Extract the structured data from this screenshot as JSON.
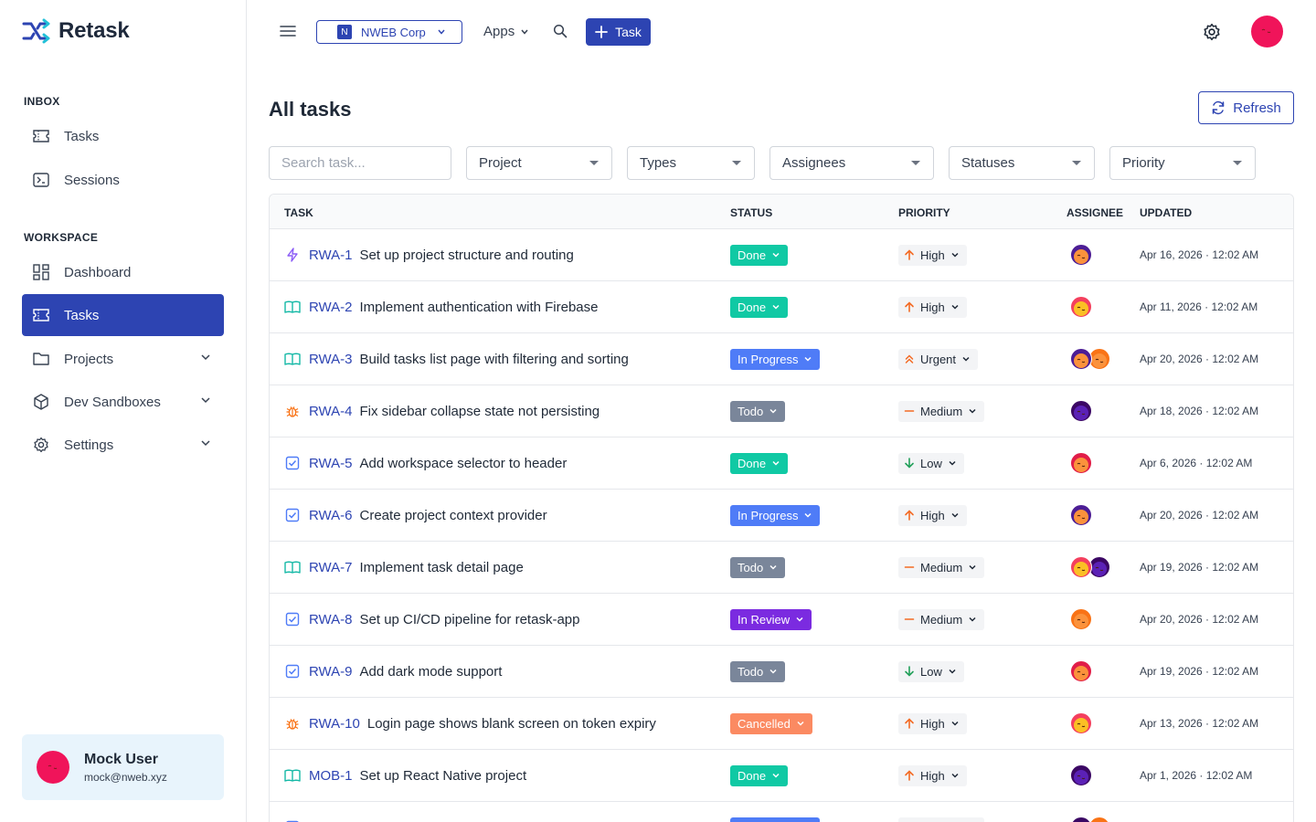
{
  "brand": {
    "name": "Retask"
  },
  "sidebar": {
    "inbox_label": "INBOX",
    "inbox_items": [
      {
        "label": "Tasks",
        "icon": "ticket-icon"
      },
      {
        "label": "Sessions",
        "icon": "terminal-icon"
      }
    ],
    "workspace_label": "WORKSPACE",
    "workspace_items": [
      {
        "label": "Dashboard",
        "icon": "dashboard-icon"
      },
      {
        "label": "Tasks",
        "icon": "ticket-icon",
        "active": true
      },
      {
        "label": "Projects",
        "icon": "folder-icon",
        "expandable": true
      },
      {
        "label": "Dev Sandboxes",
        "icon": "cube-icon",
        "expandable": true
      },
      {
        "label": "Settings",
        "icon": "gear-icon",
        "expandable": true
      }
    ],
    "user": {
      "name": "Mock User",
      "email": "mock@nweb.xyz"
    }
  },
  "header": {
    "org": {
      "badge": "N",
      "name": "NWEB Corp"
    },
    "apps_label": "Apps",
    "new_task_label": "Task"
  },
  "main": {
    "title": "All tasks",
    "refresh_label": "Refresh",
    "search_placeholder": "Search task...",
    "filters": [
      "Project",
      "Types",
      "Assignees",
      "Statuses",
      "Priority"
    ],
    "columns": [
      "TASK",
      "STATUS",
      "PRIORITY",
      "ASSIGNEE",
      "UPDATED"
    ],
    "rows": [
      {
        "type": "epic",
        "key": "RWA-1",
        "title": "Set up project structure and routing",
        "status": "Done",
        "priority": "High",
        "assignees": [
          "a1"
        ],
        "updated": "Apr 16, 2026 · 12:02 AM"
      },
      {
        "type": "story",
        "key": "RWA-2",
        "title": "Implement authentication with Firebase",
        "status": "Done",
        "priority": "High",
        "assignees": [
          "a2"
        ],
        "updated": "Apr 11, 2026 · 12:02 AM"
      },
      {
        "type": "story",
        "key": "RWA-3",
        "title": "Build tasks list page with filtering and sorting",
        "status": "In Progress",
        "priority": "Urgent",
        "assignees": [
          "a1",
          "a3"
        ],
        "updated": "Apr 20, 2026 · 12:02 AM"
      },
      {
        "type": "bug",
        "key": "RWA-4",
        "title": "Fix sidebar collapse state not persisting",
        "status": "Todo",
        "priority": "Medium",
        "assignees": [
          "a4"
        ],
        "updated": "Apr 18, 2026 · 12:02 AM"
      },
      {
        "type": "task",
        "key": "RWA-5",
        "title": "Add workspace selector to header",
        "status": "Done",
        "priority": "Low",
        "assignees": [
          "a5"
        ],
        "updated": "Apr 6, 2026 · 12:02 AM"
      },
      {
        "type": "task",
        "key": "RWA-6",
        "title": "Create project context provider",
        "status": "In Progress",
        "priority": "High",
        "assignees": [
          "a1"
        ],
        "updated": "Apr 20, 2026 · 12:02 AM"
      },
      {
        "type": "story",
        "key": "RWA-7",
        "title": "Implement task detail page",
        "status": "Todo",
        "priority": "Medium",
        "assignees": [
          "a2",
          "a4"
        ],
        "updated": "Apr 19, 2026 · 12:02 AM"
      },
      {
        "type": "task",
        "key": "RWA-8",
        "title": "Set up CI/CD pipeline for retask-app",
        "status": "In Review",
        "priority": "Medium",
        "assignees": [
          "a3"
        ],
        "updated": "Apr 20, 2026 · 12:02 AM"
      },
      {
        "type": "task",
        "key": "RWA-9",
        "title": "Add dark mode support",
        "status": "Todo",
        "priority": "Low",
        "assignees": [
          "a5"
        ],
        "updated": "Apr 19, 2026 · 12:02 AM"
      },
      {
        "type": "bug",
        "key": "RWA-10",
        "title": "Login page shows blank screen on token expiry",
        "status": "Cancelled",
        "priority": "High",
        "assignees": [
          "a2"
        ],
        "updated": "Apr 13, 2026 · 12:02 AM"
      },
      {
        "type": "story",
        "key": "MOB-1",
        "title": "Set up React Native project",
        "status": "Done",
        "priority": "High",
        "assignees": [
          "a4"
        ],
        "updated": "Apr 1, 2026 · 12:02 AM"
      },
      {
        "type": "task",
        "key": "",
        "title": "",
        "status": "In Progress",
        "priority": "",
        "assignees": [
          "a4",
          "a3"
        ],
        "updated": ""
      }
    ]
  },
  "colors": {
    "accent": "#2d44b2",
    "status": {
      "Done": "#10c9a4",
      "In Progress": "#4f7cf7",
      "Todo": "#7a869a",
      "In Review": "#7b2be0",
      "Cancelled": "#fb8a62"
    },
    "priority": {
      "High": "#f36b24",
      "Urgent": "#f36b24",
      "Medium": "#f36b24",
      "Low": "#22a05a"
    },
    "type": {
      "epic": "#8b5cf6",
      "story": "#14b8a6",
      "bug": "#f97316",
      "task": "#4f7cf7"
    },
    "avatars": {
      "a1": [
        "#4c1d95",
        "#fb923c"
      ],
      "a2": [
        "#f43f5e",
        "#fbbf24"
      ],
      "a3": [
        "#f97316",
        "#fb923c"
      ],
      "a4": [
        "#3b0764",
        "#5b21b6"
      ],
      "a5": [
        "#e11d48",
        "#fb923c"
      ]
    }
  }
}
